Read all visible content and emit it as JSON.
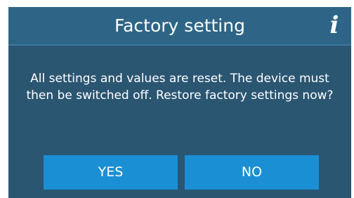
{
  "dialog": {
    "title": "Factory setting",
    "info_icon": "info-icon",
    "message": "All settings and values are reset. The device must then be switched off. Restore factory settings now?",
    "yes_label": "YES",
    "no_label": "NO"
  },
  "colors": {
    "background": "#2b5672",
    "titlebar": "#2e6587",
    "button": "#1b8fd4",
    "text": "#ffffff"
  }
}
